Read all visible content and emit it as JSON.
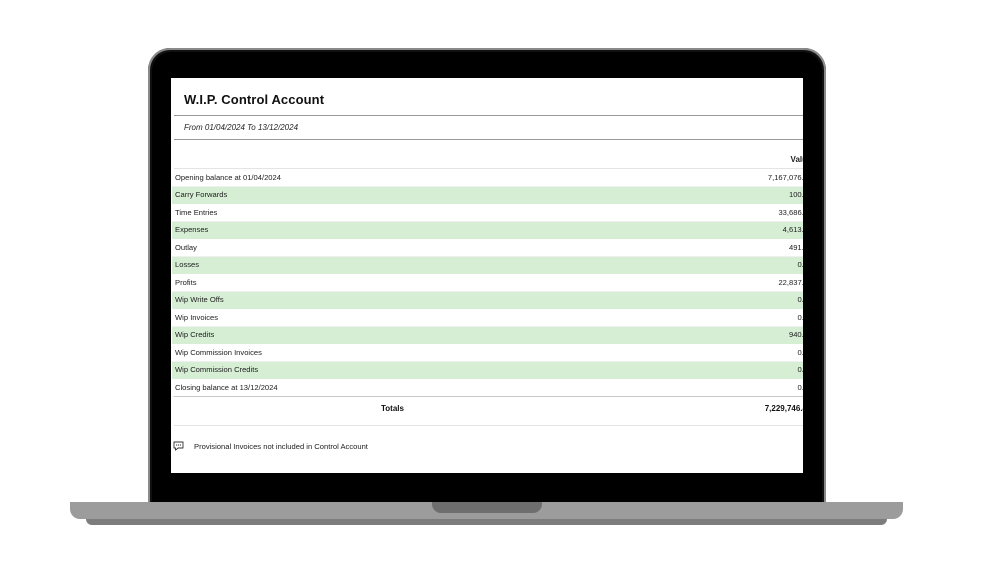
{
  "report": {
    "title": "W.I.P. Control Account",
    "date_range": "From 01/04/2024 To 13/12/2024",
    "column_header": "Valu",
    "rows": [
      {
        "label": "Opening balance at 01/04/2024",
        "value": "7,167,076.6"
      },
      {
        "label": "Carry Forwards",
        "value": "100.0"
      },
      {
        "label": "Time Entries",
        "value": "33,686.8"
      },
      {
        "label": "Expenses",
        "value": "4,613.8"
      },
      {
        "label": "Outlay",
        "value": "491.3"
      },
      {
        "label": "Losses",
        "value": "0.0"
      },
      {
        "label": "Profits",
        "value": "22,837.8"
      },
      {
        "label": "Wip Write Offs",
        "value": "0.0"
      },
      {
        "label": "Wip Invoices",
        "value": "0.0"
      },
      {
        "label": "Wip Credits",
        "value": "940.0"
      },
      {
        "label": "Wip Commission Invoices",
        "value": "0.0"
      },
      {
        "label": "Wip Commission Credits",
        "value": "0.0"
      },
      {
        "label": "Closing balance at 13/12/2024",
        "value": "0.0"
      }
    ],
    "totals_label": "Totals",
    "totals_value": "7,229,746.4",
    "note": "Provisional Invoices not included in Control Account",
    "note_icon": "comment-icon",
    "row_highlight_color": "#d6eed4"
  }
}
